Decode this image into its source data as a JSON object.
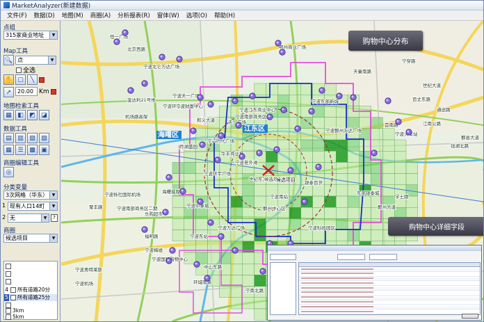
{
  "window": {
    "title": "MarketAnalyzer(新建数据)"
  },
  "menu": [
    "文件(F)",
    "数据(D)",
    "地图(M)",
    "商圈(A)",
    "分析报表(R)",
    "窗体(W)",
    "选项(O)",
    "帮助(H)"
  ],
  "left_panel": {
    "point_group_label": "点组",
    "point_group_value": "315家商业地址",
    "map_tools_label": "Map工具",
    "point_combo": "点",
    "select_all": "全选",
    "distance_value": "20.00",
    "distance_unit": "Km",
    "map_search_label": "地图检索工具",
    "data_tools_label": "数据工具",
    "area_edit_label": "商圈编辑工具",
    "category_label": "分类变量",
    "grid_value": "3次网格（华东）",
    "pop_value": "现有人口14町",
    "num_1": "1",
    "num_2": "2",
    "none_value": "无",
    "area_label": "商圈",
    "candidate_value": "候选项目",
    "list_items": [
      {
        "num": "4",
        "label": "所有道路20分"
      },
      {
        "num": "5",
        "label": "所有道路25分"
      },
      {
        "num": "",
        "label": ""
      },
      {
        "num": "",
        "label": "3km"
      },
      {
        "num": "",
        "label": "5km"
      }
    ]
  },
  "callouts": {
    "top": "购物中心分布",
    "bottom": "购物中心详细字段"
  },
  "map_labels": {
    "districts": [
      "海曙区",
      "江东区"
    ],
    "places": [
      "恒一广场",
      "北京西路",
      "宁波北仑万达广场",
      "明州商业广场",
      "宁波天一广场",
      "宁波南部商务区",
      "宁波环球城",
      "宁波财富中心",
      "和义大道",
      "宁波江东商业中心",
      "宁波东部新城",
      "宁波鄞州万达广场",
      "天一广场",
      "宁兴时代广场",
      "月湖盛园",
      "华丰商业城",
      "宁波老外滩",
      "宁波环宇广场",
      "海曙城隍庙",
      "宁波南站",
      "银泰百货",
      "世纪东方商城",
      "东部银泰城",
      "宁波印象城",
      "鄞州中心区",
      "宁波万达广场",
      "宁波科技园区",
      "宁波南部商务区二期",
      "乐购超市",
      "宁波国际购物中心",
      "宁波梅墟",
      "宁波奥特莱斯",
      "候选项目",
      "金达利21号地",
      "机场路高架",
      "宁波栎社国际机场",
      "聚丰路",
      "福明路",
      "中山东路",
      "环城南路",
      "宁南北路",
      "宁穿路",
      "世纪大道",
      "百丈东路",
      "兴宁路",
      "通途路",
      "江南公路",
      "鄞县大道",
      "钱湖北路",
      "首南路",
      "天童南路",
      "学士路",
      "鄞州大道",
      "宁波东站",
      "宁波火车站",
      "宁波机场"
    ],
    "candidate": "候选项目"
  },
  "colors": {
    "menu_bg": "#f0f0f0",
    "panel_bg": "#ece9d8",
    "map_bg": "#eaf0e4",
    "grid_light": "#b9eb9e",
    "grid_dark": "#1d9a1d",
    "boundary_blue": "#1c2dc8",
    "boundary_magenta": "#e54ce0",
    "callout": "#4a4a56"
  }
}
